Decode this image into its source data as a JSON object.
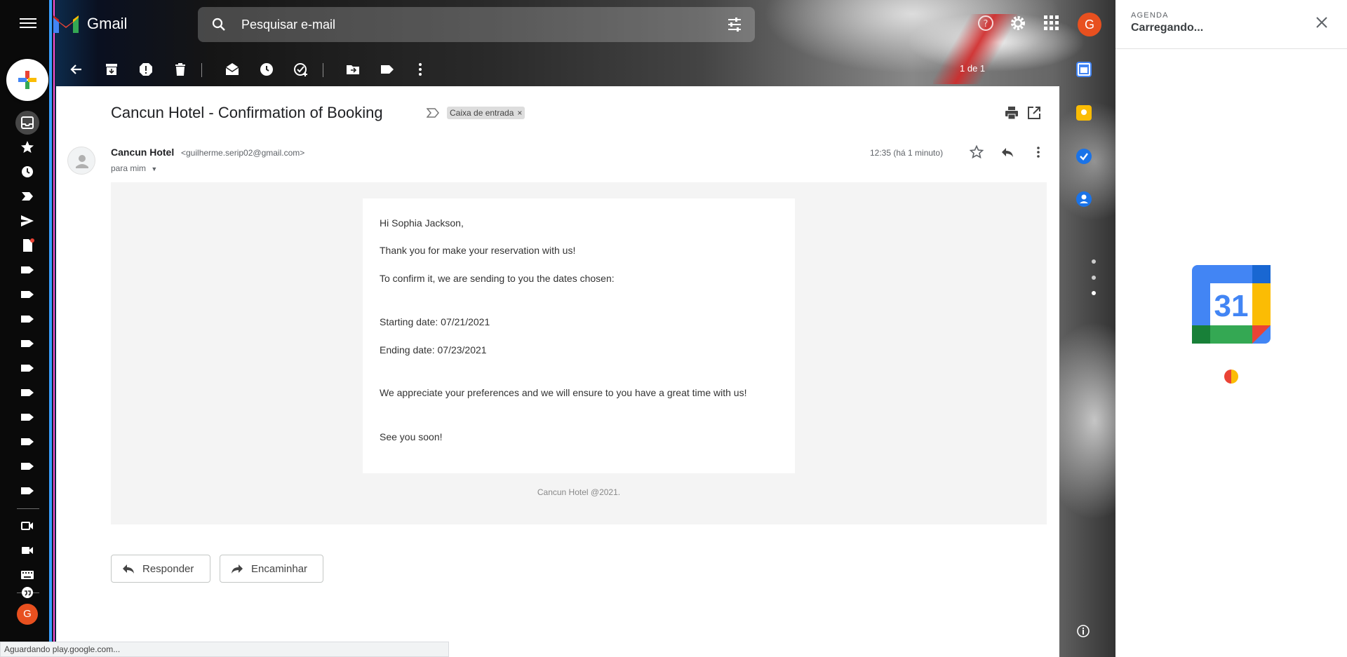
{
  "app": {
    "name": "Gmail"
  },
  "search": {
    "placeholder": "Pesquisar e-mail"
  },
  "toolbar": {
    "page_count": "1 de 1"
  },
  "message": {
    "subject": "Cancun Hotel - Confirmation of Booking",
    "label": "Caixa de entrada",
    "sender_name": "Cancun Hotel",
    "sender_email": "<guilherme.serip02@gmail.com>",
    "to": "para mim",
    "time": "12:35 (há 1 minuto)",
    "body": {
      "greeting": "Hi Sophia Jackson,",
      "line1": "Thank you for make your reservation with us!",
      "line2": "To confirm it, we are sending to you the dates chosen:",
      "start": "Starting date: 07/21/2021",
      "end": "Ending date: 07/23/2021",
      "line3": "We appreciate your preferences and we will ensure to you have a great time with us!",
      "closing": "See you soon!"
    },
    "footer": "Cancun Hotel @2021."
  },
  "actions": {
    "reply": "Responder",
    "forward": "Encaminhar"
  },
  "user": {
    "initial": "G"
  },
  "calendar_panel": {
    "app": "AGENDA",
    "status": "Carregando...",
    "logo_number": "31"
  },
  "status_bar": "Aguardando play.google.com...",
  "icons": [
    "menu-icon",
    "search-icon",
    "filter-icon",
    "help-icon",
    "settings-icon",
    "apps-icon",
    "back-icon",
    "archive-icon",
    "report-spam-icon",
    "delete-icon",
    "mark-unread-icon",
    "snooze-icon",
    "add-task-icon",
    "move-to-icon",
    "label-icon",
    "more-icon",
    "print-icon",
    "open-new-window-icon",
    "star-icon",
    "reply-icon"
  ],
  "colors": {
    "accent_red": "#ea4335",
    "avatar": "#e8501f",
    "compose_bg": "#ffffff"
  }
}
